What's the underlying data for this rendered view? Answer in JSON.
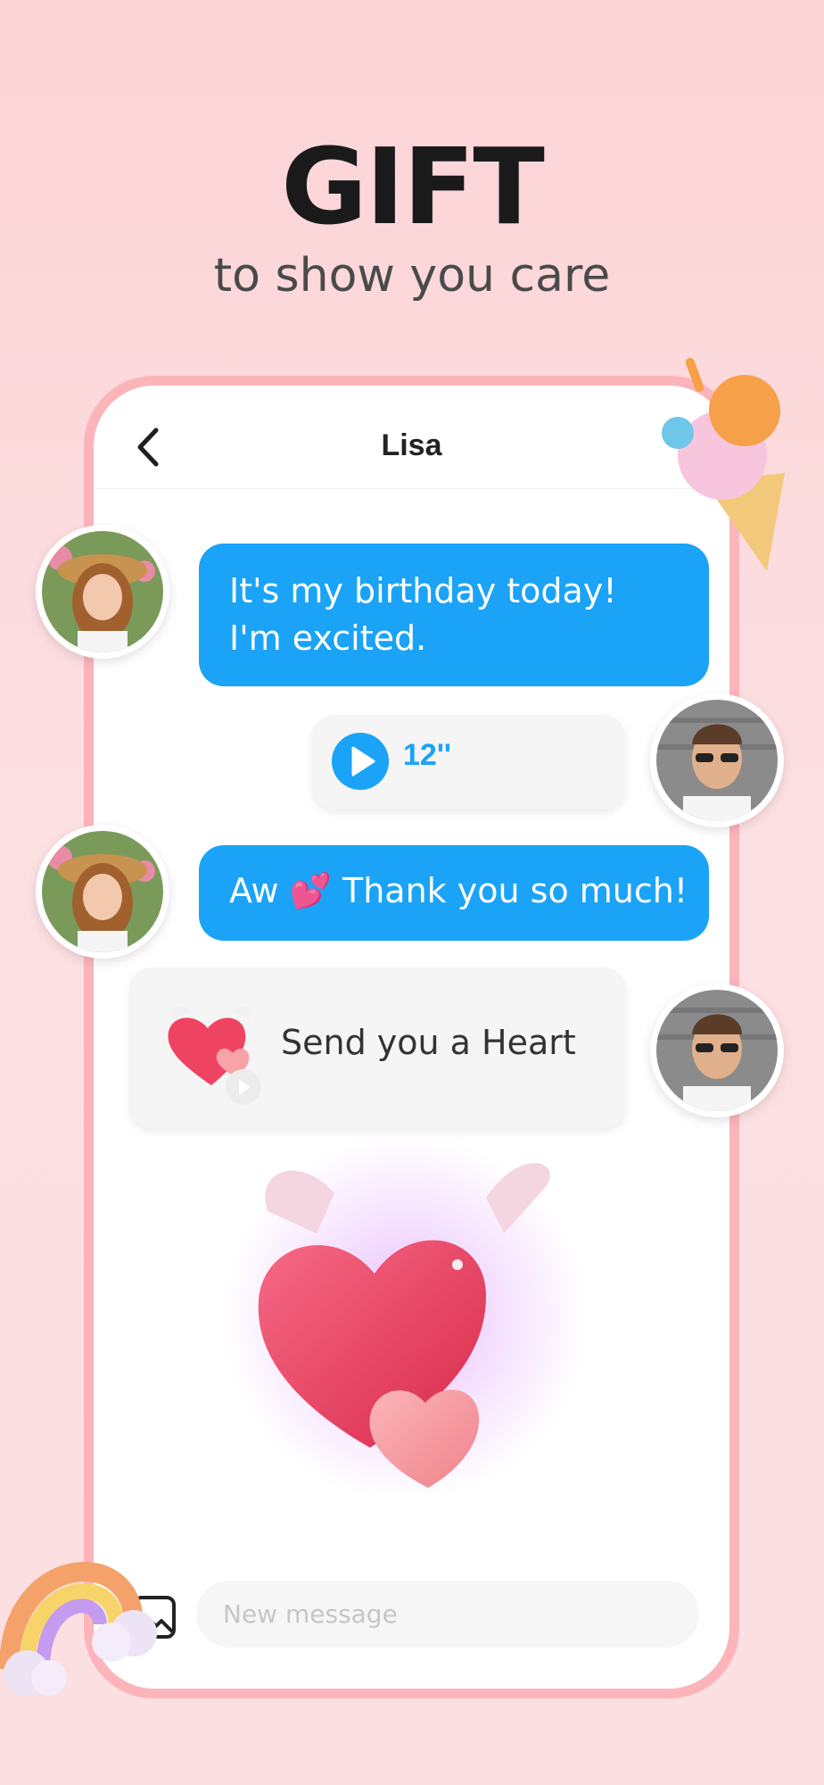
{
  "hero": {
    "title": "GIFT",
    "subtitle": "to show you care"
  },
  "chat": {
    "contact_name": "Lisa",
    "messages": [
      {
        "type": "text",
        "text": "It's my birthday today! I'm excited."
      },
      {
        "type": "voice",
        "duration": "12''"
      },
      {
        "type": "text",
        "text": "Aw 💕 Thank you so much!"
      },
      {
        "type": "gift",
        "text": "Send you a Heart"
      }
    ]
  },
  "composer": {
    "placeholder": "New message"
  },
  "colors": {
    "accent": "#1aa3f7",
    "background": "#fbd3d6",
    "frame": "#fbb5ba",
    "heart": "#f0445f"
  },
  "icons": [
    "back-arrow-icon",
    "play-icon",
    "image-icon",
    "heart-icon",
    "ice-cream-icon",
    "rainbow-icon"
  ]
}
